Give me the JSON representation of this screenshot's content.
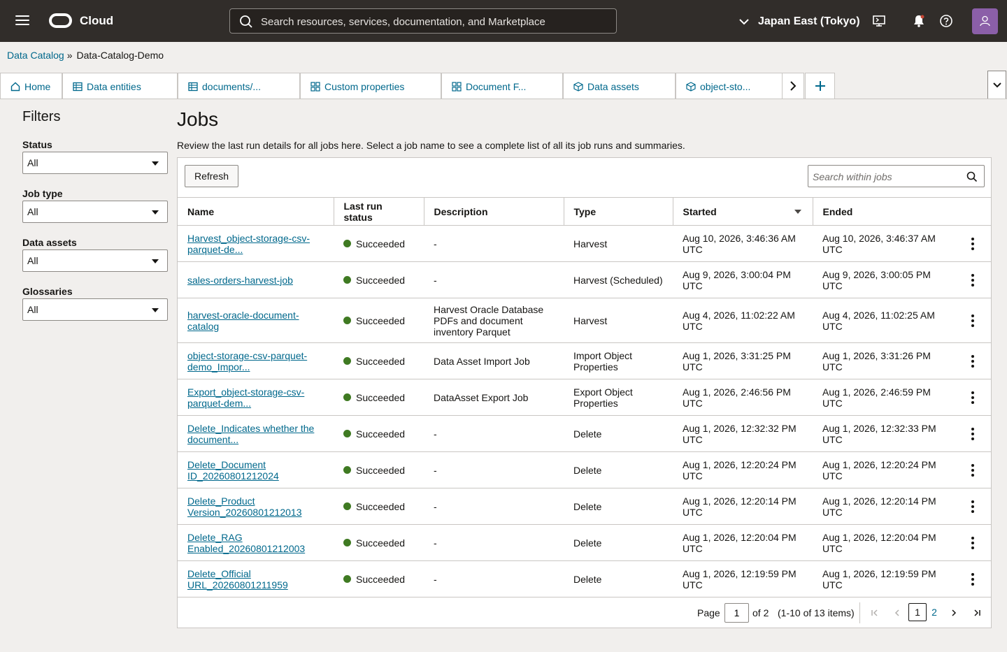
{
  "header": {
    "logo_text": "Cloud",
    "search_placeholder": "Search resources, services, documentation, and Marketplace",
    "region": "Japan East (Tokyo)"
  },
  "breadcrumb": {
    "parent": "Data Catalog",
    "separator": "»",
    "current": "Data-Catalog-Demo"
  },
  "tabs": [
    {
      "label": "Home",
      "icon": "home-icon"
    },
    {
      "label": "Data entities",
      "icon": "table-icon"
    },
    {
      "label": "documents/...",
      "icon": "table-icon"
    },
    {
      "label": "Custom properties",
      "icon": "grid-icon"
    },
    {
      "label": "Document F...",
      "icon": "grid-icon"
    },
    {
      "label": "Data assets",
      "icon": "cube-icon"
    },
    {
      "label": "object-sto...",
      "icon": "cube-icon"
    }
  ],
  "filters": {
    "title": "Filters",
    "items": [
      {
        "label": "Status",
        "value": "All"
      },
      {
        "label": "Job type",
        "value": "All"
      },
      {
        "label": "Data assets",
        "value": "All"
      },
      {
        "label": "Glossaries",
        "value": "All"
      }
    ]
  },
  "main": {
    "title": "Jobs",
    "description": "Review the last run details for all jobs here. Select a job name to see a complete list of all its job runs and summaries.",
    "refresh_label": "Refresh",
    "search_placeholder": "Search within jobs"
  },
  "table": {
    "columns": [
      "Name",
      "Last run status",
      "Description",
      "Type",
      "Started",
      "Ended"
    ],
    "rows": [
      {
        "name": [
          "Harvest_object-storage-csv-",
          "parquet-de..."
        ],
        "status": "Succeeded",
        "description": [
          "-"
        ],
        "type": [
          "Harvest"
        ],
        "started": [
          "Aug 10, 2026, 3:46:36 AM",
          "UTC"
        ],
        "ended": [
          "Aug 10, 2026, 3:46:37 AM",
          "UTC"
        ]
      },
      {
        "name": [
          "sales-orders-harvest-job"
        ],
        "status": "Succeeded",
        "description": [
          "-"
        ],
        "type": [
          "Harvest (Scheduled)"
        ],
        "started": [
          "Aug 9, 2026, 3:00:04 PM",
          "UTC"
        ],
        "ended": [
          "Aug 9, 2026, 3:00:05 PM",
          "UTC"
        ]
      },
      {
        "name": [
          "harvest-oracle-document-",
          "catalog"
        ],
        "status": "Succeeded",
        "description": [
          "Harvest Oracle Database",
          "PDFs and document",
          "inventory Parquet"
        ],
        "type": [
          "Harvest"
        ],
        "started": [
          "Aug 4, 2026, 11:02:22 AM",
          "UTC"
        ],
        "ended": [
          "Aug 4, 2026, 11:02:25 AM",
          "UTC"
        ]
      },
      {
        "name": [
          "object-storage-csv-parquet-",
          "demo_Impor..."
        ],
        "status": "Succeeded",
        "description": [
          "Data Asset Import Job"
        ],
        "type": [
          "Import Object",
          "Properties"
        ],
        "started": [
          "Aug 1, 2026, 3:31:25 PM",
          "UTC"
        ],
        "ended": [
          "Aug 1, 2026, 3:31:26 PM",
          "UTC"
        ]
      },
      {
        "name": [
          "Export_object-storage-csv-",
          "parquet-dem..."
        ],
        "status": "Succeeded",
        "description": [
          "DataAsset Export Job"
        ],
        "type": [
          "Export Object",
          "Properties"
        ],
        "started": [
          "Aug 1, 2026, 2:46:56 PM",
          "UTC"
        ],
        "ended": [
          "Aug 1, 2026, 2:46:59 PM",
          "UTC"
        ]
      },
      {
        "name": [
          "Delete_Indicates whether the",
          "document..."
        ],
        "status": "Succeeded",
        "description": [
          "-"
        ],
        "type": [
          "Delete"
        ],
        "started": [
          "Aug 1, 2026, 12:32:32 PM",
          "UTC"
        ],
        "ended": [
          "Aug 1, 2026, 12:32:33 PM",
          "UTC"
        ]
      },
      {
        "name": [
          "Delete_Document",
          "ID_20260801212024"
        ],
        "status": "Succeeded",
        "description": [
          "-"
        ],
        "type": [
          "Delete"
        ],
        "started": [
          "Aug 1, 2026, 12:20:24 PM",
          "UTC"
        ],
        "ended": [
          "Aug 1, 2026, 12:20:24 PM",
          "UTC"
        ]
      },
      {
        "name": [
          "Delete_Product",
          "Version_20260801212013"
        ],
        "status": "Succeeded",
        "description": [
          "-"
        ],
        "type": [
          "Delete"
        ],
        "started": [
          "Aug 1, 2026, 12:20:14 PM",
          "UTC"
        ],
        "ended": [
          "Aug 1, 2026, 12:20:14 PM",
          "UTC"
        ]
      },
      {
        "name": [
          "Delete_RAG",
          "Enabled_20260801212003"
        ],
        "status": "Succeeded",
        "description": [
          "-"
        ],
        "type": [
          "Delete"
        ],
        "started": [
          "Aug 1, 2026, 12:20:04 PM",
          "UTC"
        ],
        "ended": [
          "Aug 1, 2026, 12:20:04 PM",
          "UTC"
        ]
      },
      {
        "name": [
          "Delete_Official",
          "URL_20260801211959"
        ],
        "status": "Succeeded",
        "description": [
          "-"
        ],
        "type": [
          "Delete"
        ],
        "started": [
          "Aug 1, 2026, 12:19:59 PM",
          "UTC"
        ],
        "ended": [
          "Aug 1, 2026, 12:19:59 PM",
          "UTC"
        ]
      }
    ]
  },
  "pagination": {
    "page_label": "Page",
    "current_page": "1",
    "of_label": "of 2",
    "items_label": "(1-10 of 13 items)",
    "pages": [
      "1",
      "2"
    ]
  },
  "colors": {
    "header_bg": "#312d2a",
    "link": "#00688c",
    "success": "#3f7a22",
    "avatar": "#8b5fa8"
  }
}
